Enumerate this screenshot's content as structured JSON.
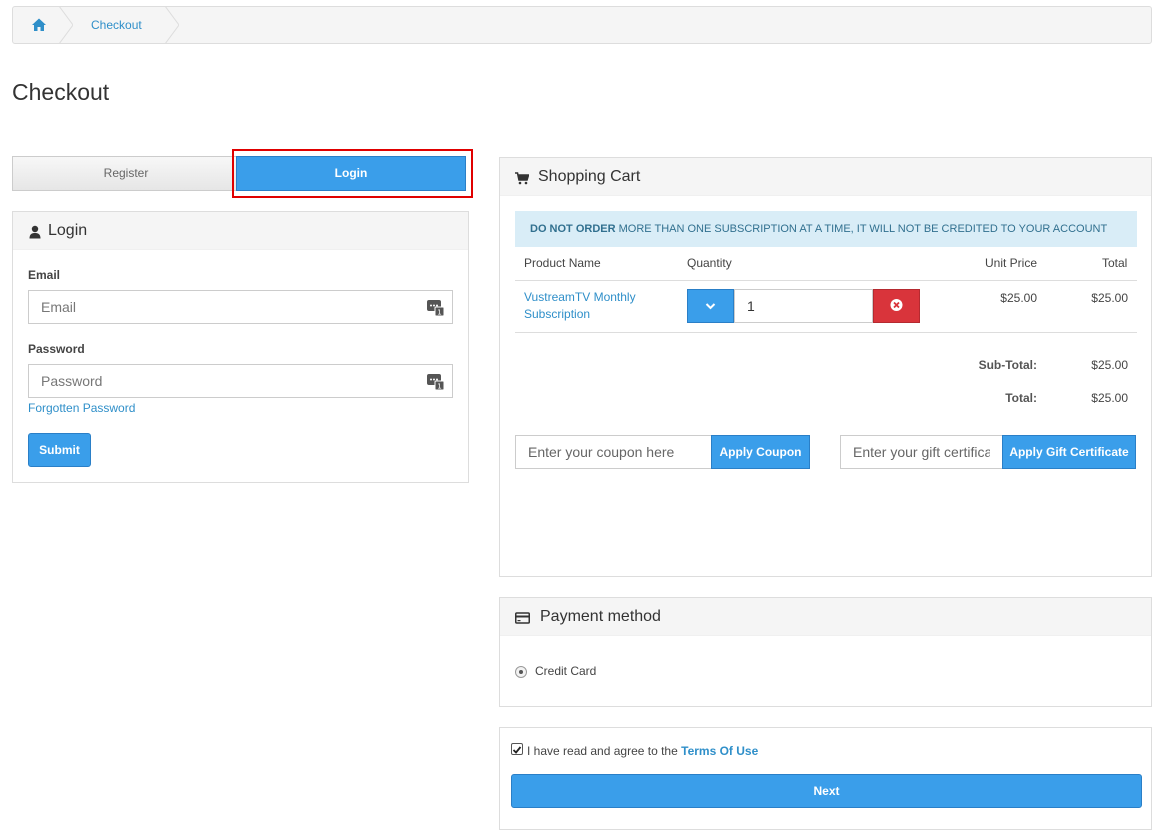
{
  "breadcrumb": {
    "home_icon": "home-icon",
    "current": "Checkout"
  },
  "page": {
    "title": "Checkout"
  },
  "tabs": {
    "register": "Register",
    "login": "Login"
  },
  "login": {
    "title": "Login",
    "icon": "user-icon",
    "email_label": "Email",
    "email_placeholder": "Email",
    "password_label": "Password",
    "password_placeholder": "Password",
    "forgot": "Forgotten Password",
    "submit": "Submit"
  },
  "cart": {
    "title": "Shopping Cart",
    "icon": "cart-icon",
    "alert_bold": "DO NOT ORDER",
    "alert_rest": " MORE THAN ONE SUBSCRIPTION AT A TIME, IT WILL NOT BE CREDITED TO YOUR ACCOUNT",
    "columns": {
      "product": "Product Name",
      "quantity": "Quantity",
      "unit_price": "Unit Price",
      "total": "Total"
    },
    "items": [
      {
        "name": "VustreamTV Monthly Subscription",
        "quantity": "1",
        "unit_price": "$25.00",
        "total": "$25.00"
      }
    ],
    "subtotal_label": "Sub-Total:",
    "subtotal_value": "$25.00",
    "total_label": "Total:",
    "total_value": "$25.00",
    "coupon_placeholder": "Enter your coupon here",
    "coupon_button": "Apply Coupon",
    "gift_placeholder": "Enter your gift certificate code here",
    "gift_button": "Apply Gift Certificate"
  },
  "payment": {
    "title": "Payment method",
    "icon": "credit-card-icon",
    "option": "Credit Card",
    "selected": true
  },
  "terms": {
    "text": "I have read and agree to the ",
    "link": "Terms Of Use",
    "checked": true,
    "next_button": "Next"
  },
  "colors": {
    "primary": "#3a9eea",
    "danger": "#d9343b",
    "link": "#2f8fc9",
    "highlight_border": "#e00000",
    "alert_bg": "#d9edf7"
  }
}
